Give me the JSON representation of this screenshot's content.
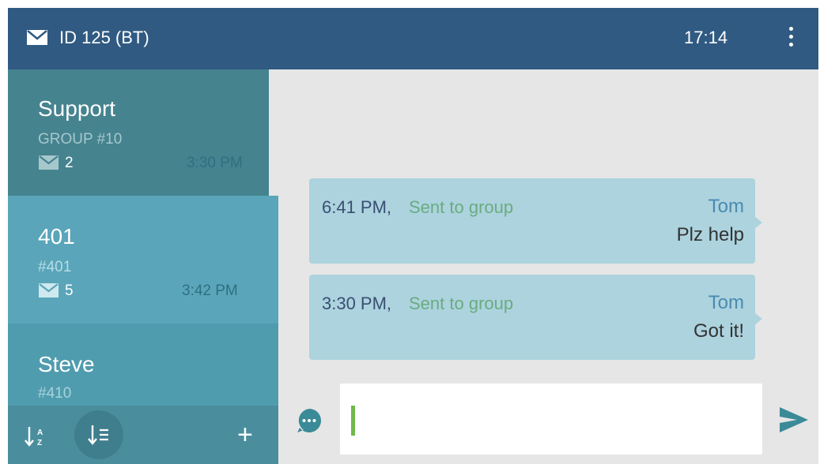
{
  "header": {
    "title": "ID 125 (BT)",
    "time": "17:14",
    "icons": {
      "mail": "mail-icon",
      "menu": "more-vert-icon"
    }
  },
  "conversations": [
    {
      "name": "Support",
      "subtitle": "GROUP #10",
      "unread": "2",
      "time": "3:30 PM"
    },
    {
      "name": "401",
      "subtitle": "#401",
      "unread": "5",
      "time": "3:42 PM"
    },
    {
      "name": "Steve",
      "subtitle": "#410"
    }
  ],
  "toolbar": {
    "icons": {
      "sort_alpha": "sort-alpha-icon",
      "sort_list": "sort-list-icon",
      "add": "add-icon"
    },
    "add_label": "+"
  },
  "messages": [
    {
      "time": "6:41 PM,",
      "status": "Sent to group",
      "sender": "Tom",
      "text": "Plz help"
    },
    {
      "time": "3:30 PM,",
      "status": "Sent to group",
      "sender": "Tom",
      "text": "Got it!"
    }
  ],
  "composer": {
    "value": "",
    "icons": {
      "emoji": "chat-bubble-icon",
      "send": "send-icon"
    }
  },
  "colors": {
    "header": "#305a82",
    "sidebar_active": "#5aa5b9",
    "bubble": "#acd3de",
    "accent_green": "#6fb94a",
    "send": "#3b8a98"
  }
}
